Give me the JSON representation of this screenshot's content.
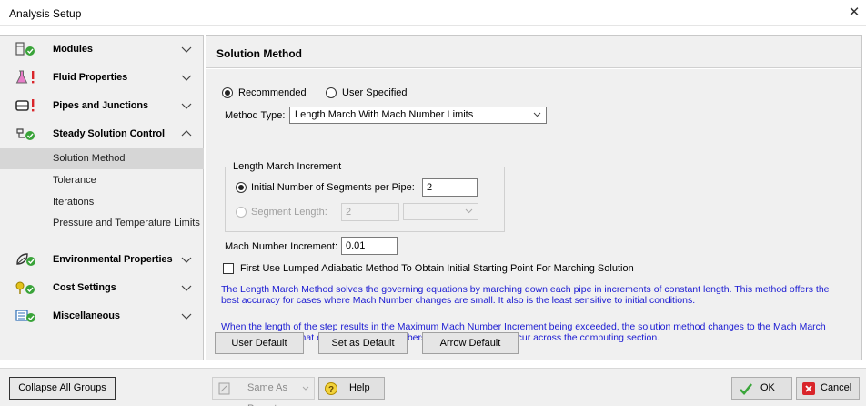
{
  "window": {
    "title": "Analysis Setup",
    "close_glyph": "✕"
  },
  "sidebar": {
    "groups": [
      {
        "label": "Modules",
        "icon": "modules-icon"
      },
      {
        "label": "Fluid Properties",
        "icon": "flask-warning-icon"
      },
      {
        "label": "Pipes and Junctions",
        "icon": "pipes-warning-icon"
      },
      {
        "label": "Steady Solution Control",
        "icon": "solution-control-icon",
        "expanded": true,
        "items": [
          "Solution Method",
          "Tolerance",
          "Iterations",
          "Pressure and Temperature Limits"
        ],
        "selected": "Solution Method"
      },
      {
        "label": "Environmental Properties",
        "icon": "environment-icon"
      },
      {
        "label": "Cost Settings",
        "icon": "cost-icon"
      },
      {
        "label": "Miscellaneous",
        "icon": "miscellaneous-icon"
      }
    ]
  },
  "main": {
    "header": "Solution Method",
    "mode": {
      "recommended": "Recommended",
      "user_specified": "User Specified",
      "selected": "Recommended"
    },
    "method_type": {
      "label": "Method Type:",
      "value": "Length March With Mach Number Limits"
    },
    "length_march": {
      "legend": "Length March Increment",
      "initial_segments_label": "Initial Number of Segments per Pipe:",
      "initial_segments_value": "2",
      "segment_length_label": "Segment Length:",
      "segment_length_value": "2",
      "segment_length_unit": ""
    },
    "mach_increment": {
      "label": "Mach Number Increment:",
      "value": "0.01"
    },
    "lumped_adiabatic": {
      "label": "First Use Lumped Adiabatic Method To Obtain Initial Starting Point For Marching Solution",
      "checked": false
    },
    "description_1": "The Length March Method solves the governing equations by marching down each pipe in increments of constant length. This method offers the best accuracy for cases where Mach Number changes are small. It also is the least sensitive to initial conditions.",
    "description_2": "When the length of the step results in the Maximum Mach Number Increment being exceeded, the solution method changes to the Mach March method to ensure that excessive Mach Numbers changes to do not occur across the computing section.",
    "buttons": {
      "user_default": "User Default",
      "set_as_default": "Set as Default",
      "arrow_default": "Arrow Default"
    }
  },
  "footer": {
    "collapse_all": "Collapse All Groups",
    "same_as_parent": "Same As Parent",
    "help": "Help",
    "ok": "OK",
    "cancel": "Cancel"
  },
  "colors": {
    "description_text": "#1a1ad2",
    "selected_item": "#d6d6d6",
    "ok_check": "#3aa63a",
    "cancel_red": "#d9252a"
  }
}
